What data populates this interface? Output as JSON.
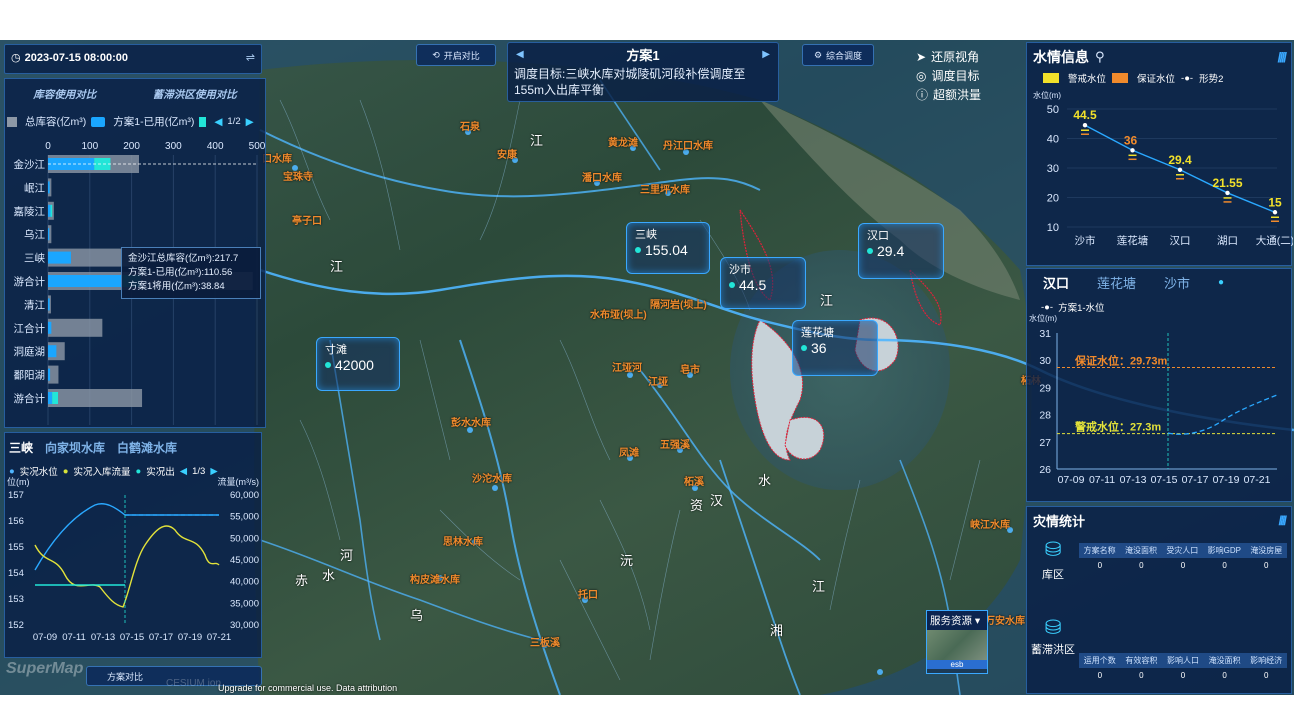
{
  "colors": {
    "accent": "#3aa8ff",
    "warning": "#f2e12a",
    "guarantee": "#f08a2c",
    "teal": "#22e5d8",
    "bar_total": "#8d98a6",
    "bar_used": "#1aa6ff",
    "bar_planned": "#22e5d8"
  },
  "topbar": {
    "datetime": "2023-07-15 08:00:00",
    "open_compare": "开启对比",
    "scheme_title": "方案1",
    "scheme_desc": "调度目标:三峡水库对城陵矶河段补偿调度至155m入出库平衡",
    "comprehensive": "综合调度",
    "restore_view": "还原视角",
    "dispatch_target": "调度目标",
    "overflow": "超额洪量"
  },
  "reservoir_panel": {
    "tab1": "库容使用对比",
    "tab2": "蓄滞洪区使用对比",
    "legend_total": "总库容(亿m³)",
    "legend_used": "方案1-已用(亿m³)",
    "page": "1/2",
    "axis_ticks": [
      "0",
      "100",
      "200",
      "300",
      "400",
      "500"
    ],
    "rows": [
      {
        "name": "金沙江",
        "total": 217.7,
        "used": 110.56,
        "planned": 38.84
      },
      {
        "name": "岷江",
        "total": 8,
        "used": 4,
        "planned": 0
      },
      {
        "name": "嘉陵江",
        "total": 14,
        "used": 6,
        "planned": 4
      },
      {
        "name": "乌江",
        "total": 8,
        "used": 3,
        "planned": 0
      },
      {
        "name": "三峡",
        "total": 221,
        "used": 55,
        "planned": 0
      },
      {
        "name": "游合计",
        "total": 490,
        "used": 175,
        "planned": 46
      },
      {
        "name": "清江",
        "total": 7,
        "used": 4,
        "planned": 0
      },
      {
        "name": "江合计",
        "total": 130,
        "used": 8,
        "planned": 0
      },
      {
        "name": "洞庭湖",
        "total": 40,
        "used": 20,
        "planned": 0
      },
      {
        "name": "鄱阳湖",
        "total": 25,
        "used": 5,
        "planned": 0
      },
      {
        "name": "游合计",
        "total": 225,
        "used": 10,
        "planned": 14
      }
    ],
    "tooltip": {
      "line1": "金沙江总库容(亿m³):217.7",
      "line2": "方案1-已用(亿m³):110.56",
      "line3": "方案1将用(亿m³):38.84"
    }
  },
  "sanxia_panel": {
    "tab1": "三峡",
    "tab2": "向家坝水库",
    "tab3": "白鹤滩水库",
    "legend1": "实况水位",
    "legend2": "实况入库流量",
    "legend3": "实况出",
    "page": "1/3",
    "left_unit": "位(m)",
    "right_unit": "流量(m³/s)",
    "left_ticks": [
      "157",
      "156",
      "155",
      "154",
      "153",
      "152"
    ],
    "right_ticks": [
      "60,000",
      "55,000",
      "50,000",
      "45,000",
      "40,000",
      "35,000",
      "30,000"
    ],
    "x_ticks": [
      "07-09",
      "07-11",
      "07-13",
      "07-15",
      "07-17",
      "07-19",
      "07-21"
    ]
  },
  "water_info": {
    "title": "水情信息",
    "legend_warning": "警戒水位",
    "legend_guarantee": "保证水位",
    "legend_trend": "形势2",
    "y_unit": "水位(m)",
    "y_ticks": [
      "50",
      "40",
      "30",
      "20",
      "10"
    ],
    "stations": [
      "沙市",
      "莲花塘",
      "汉口",
      "湖口",
      "大通(二)"
    ],
    "values": [
      "44.5",
      "36",
      "29.4",
      "21.55",
      "15"
    ]
  },
  "hankou_panel": {
    "tab1": "汉口",
    "tab2": "莲花塘",
    "tab3": "沙市",
    "legend": "方案1-水位",
    "y_unit": "水位(m)",
    "y_ticks": [
      "31",
      "30",
      "29",
      "28",
      "27",
      "26"
    ],
    "x_ticks": [
      "07-09",
      "07-11",
      "07-13",
      "07-15",
      "07-17",
      "07-19",
      "07-21"
    ],
    "guarantee_label": "保证水位：29.73m",
    "warning_label": "警戒水位：27.3m"
  },
  "disaster": {
    "title": "灾情统计",
    "reservoir_label": "库区",
    "detention_label": "蓄滞洪区",
    "reservoir_headers": [
      "方案名称",
      "淹没面积",
      "受灾人口",
      "影响GDP",
      "淹没房屋"
    ],
    "reservoir_values": [
      "0",
      "0",
      "0",
      "0",
      "0"
    ],
    "detention_headers": [
      "运用个数",
      "有效容积",
      "影响人口",
      "淹没面积",
      "影响经济"
    ],
    "detention_values": [
      "0",
      "0",
      "0",
      "0",
      "0"
    ]
  },
  "gauges": {
    "sanxia": {
      "name": "三峡",
      "value": "155.04"
    },
    "shashi": {
      "name": "沙市",
      "value": "44.5"
    },
    "hankou": {
      "name": "汉口",
      "value": "29.4"
    },
    "lianhuatang": {
      "name": "莲花塘",
      "value": "36"
    },
    "cuntan": {
      "name": "寸滩",
      "value": "42000"
    }
  },
  "map_labels": {
    "orange": [
      "口水库",
      "宝珠寺",
      "亭子口",
      "石泉",
      "安康",
      "黄龙滩",
      "丹江口水库",
      "潘口水库",
      "三里坪水库",
      "隔河岩(坝上)",
      "水布垭(坝上)",
      "江垭河",
      "江垭",
      "皂市",
      "彭水水库",
      "凤滩",
      "五强溪",
      "沙沱水库",
      "柘溪",
      "思林水库",
      "构皮滩水库",
      "托口",
      "三板溪",
      "万安水库",
      "柘林",
      "峡江水库"
    ],
    "white": [
      "江",
      "江",
      "江",
      "水",
      "汉",
      "河",
      "沅",
      "乌",
      "赤",
      "水",
      "湘",
      "资",
      "江"
    ]
  },
  "service": {
    "title": "服务资源",
    "thumb_label": "esb"
  },
  "footer": {
    "attribution": "Upgrade for commercial use. Data attribution",
    "compare_btn": "方案对比",
    "brand": "SuperMap",
    "brand2": "CESIUM ion"
  }
}
